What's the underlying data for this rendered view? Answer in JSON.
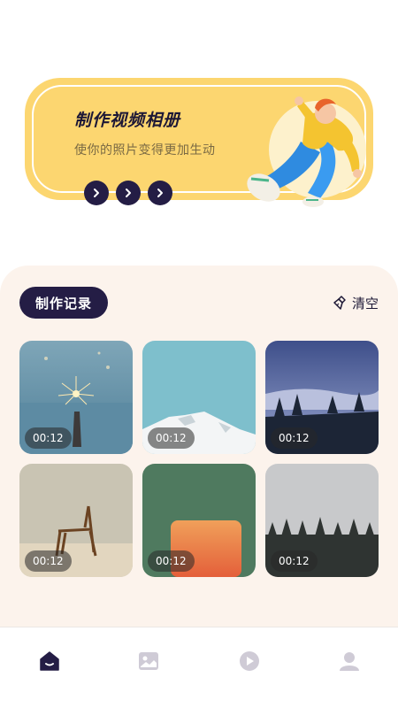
{
  "banner": {
    "title": "制作视频相册",
    "subtitle": "使你的照片变得更加生动",
    "arrows": [
      "chevron-right-icon",
      "chevron-right-icon",
      "chevron-right-icon"
    ]
  },
  "records": {
    "title": "制作记录",
    "clear_label": "清空",
    "clear_icon": "broom-icon",
    "items": [
      {
        "scene": "sparkler-over-sea",
        "duration": "00:12"
      },
      {
        "scene": "snowy-mountain",
        "duration": "00:12"
      },
      {
        "scene": "foggy-forest",
        "duration": "00:12"
      },
      {
        "scene": "chair-on-sand",
        "duration": "00:12"
      },
      {
        "scene": "green-wall-sunset",
        "duration": "00:12"
      },
      {
        "scene": "misty-pines",
        "duration": "00:12"
      }
    ]
  },
  "nav": {
    "items": [
      {
        "icon": "home-icon",
        "active": true
      },
      {
        "icon": "photo-icon",
        "active": false
      },
      {
        "icon": "play-icon",
        "active": false
      },
      {
        "icon": "profile-icon",
        "active": false
      }
    ]
  },
  "colors": {
    "accent_dark": "#241d45",
    "banner_yellow": "#fcd670",
    "panel_bg": "#fcf3ec",
    "nav_inactive": "#cfcbd6"
  }
}
